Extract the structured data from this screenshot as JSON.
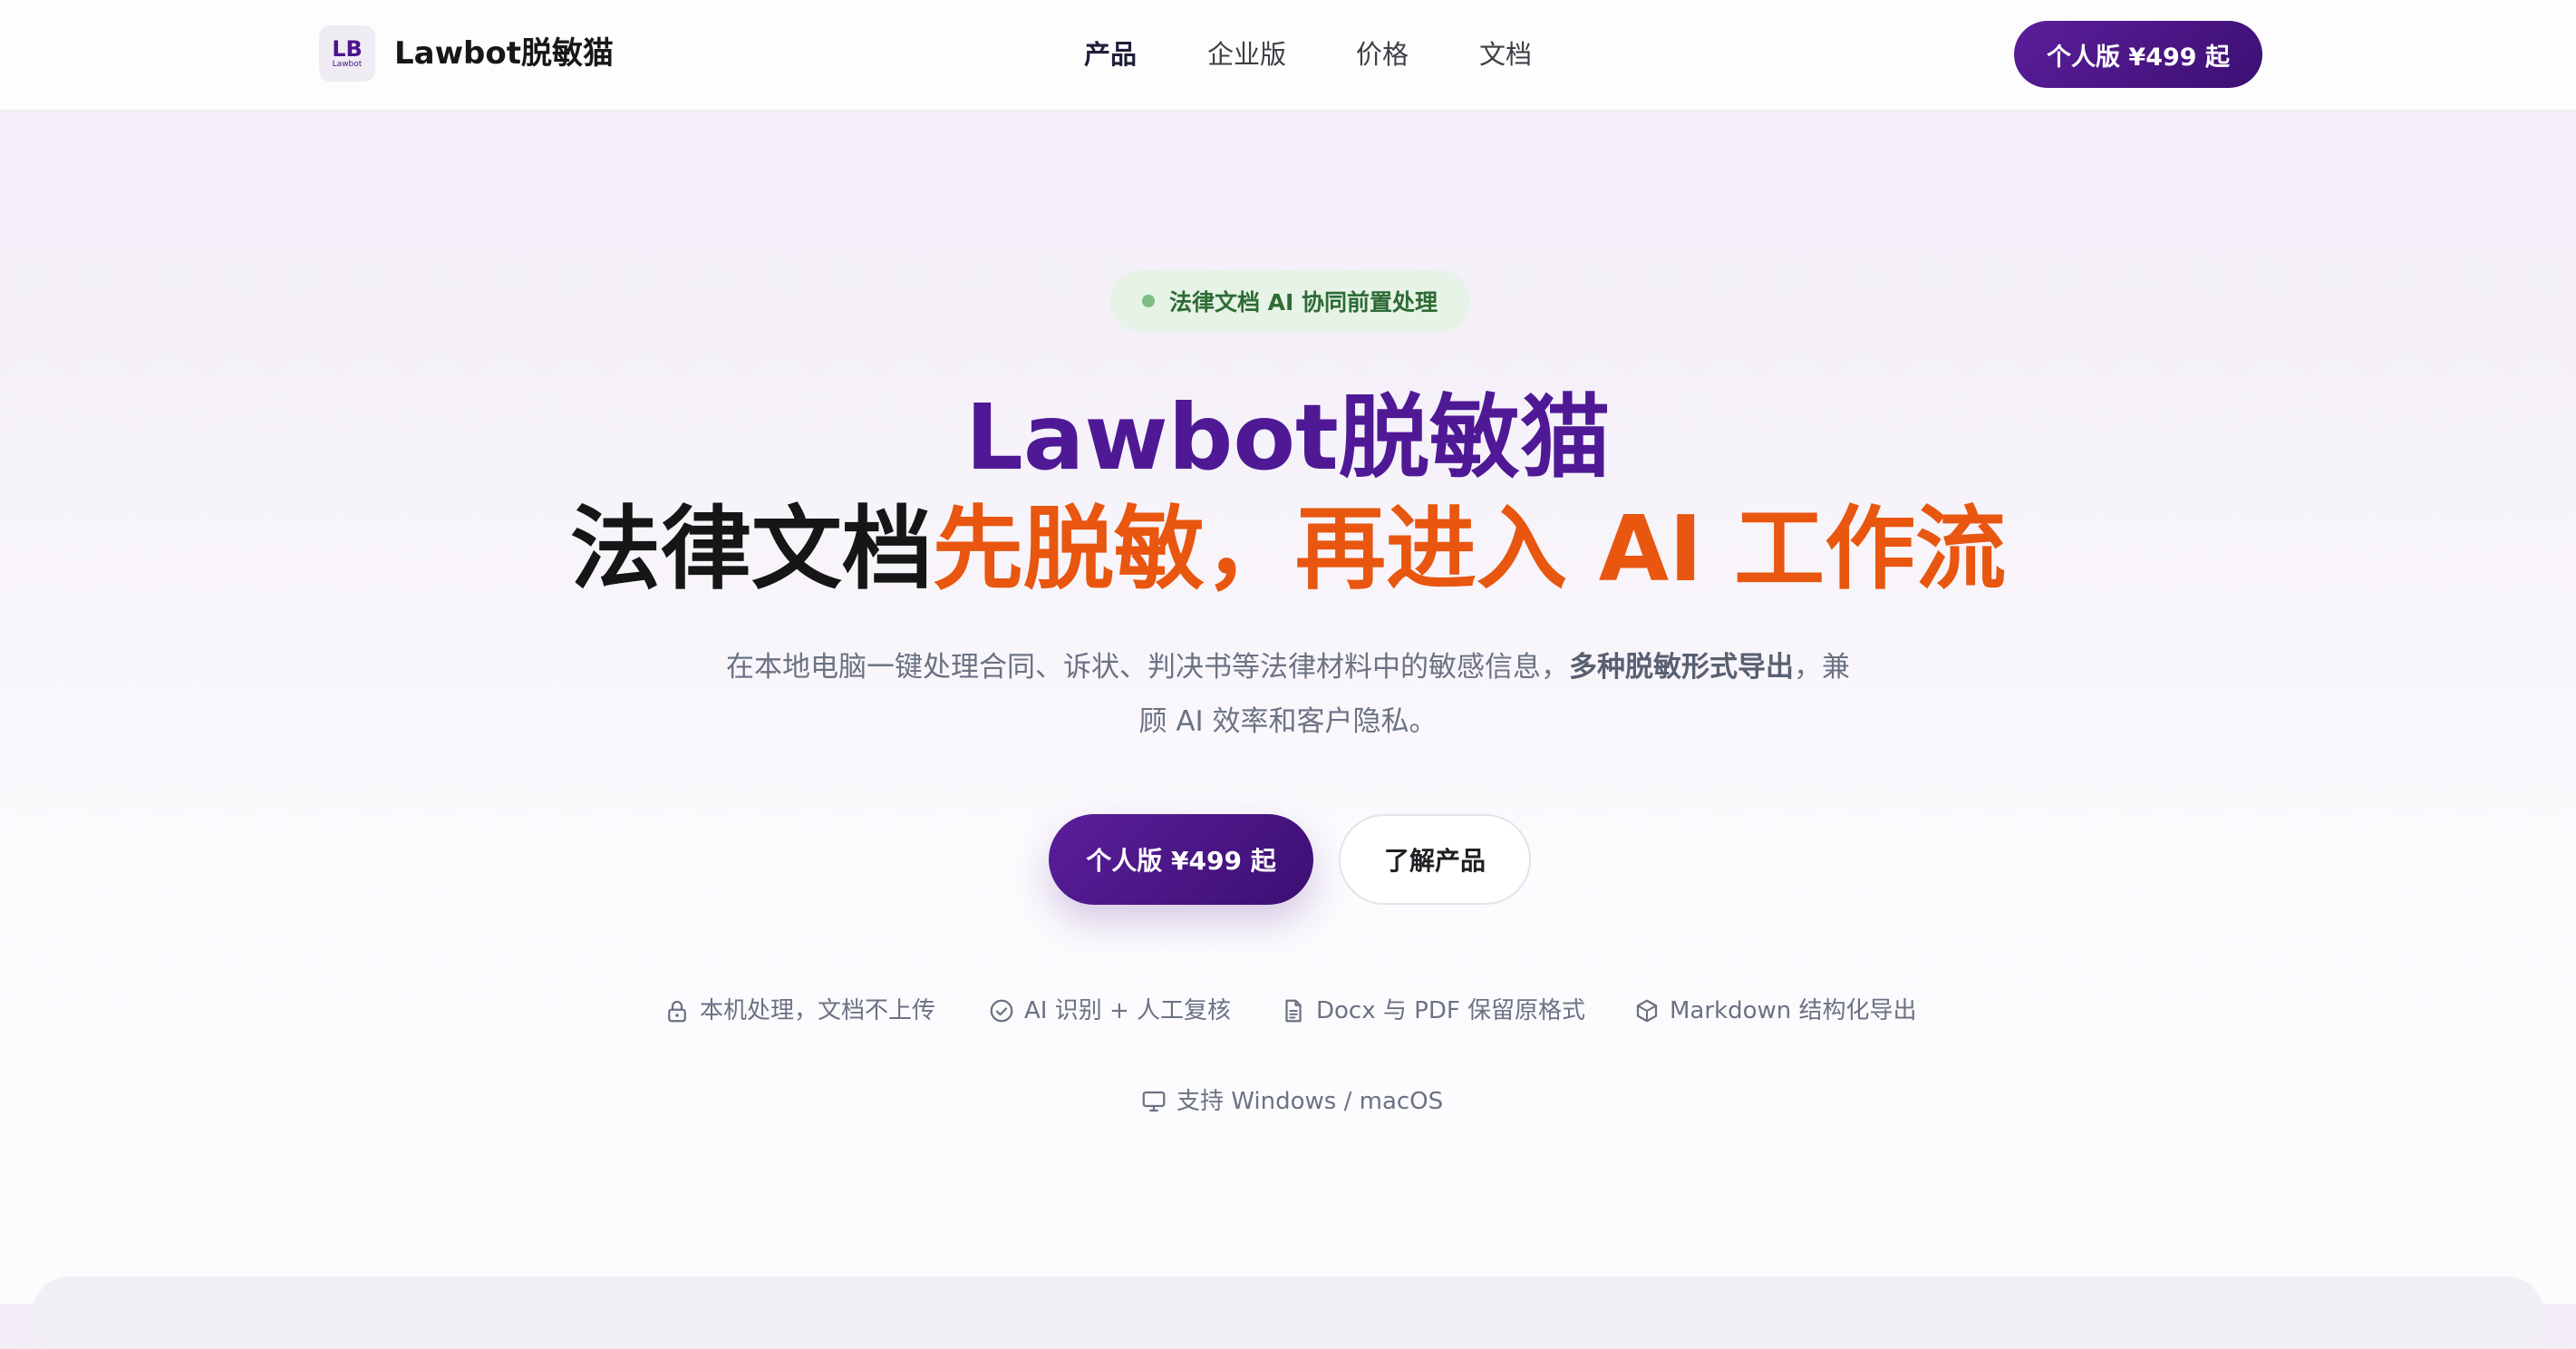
{
  "header": {
    "logo": {
      "mark": "LB",
      "caption": "Lawbot"
    },
    "brand": "Lawbot脱敏猫",
    "nav": [
      {
        "label": "产品",
        "active": true
      },
      {
        "label": "企业版",
        "active": false
      },
      {
        "label": "价格",
        "active": false
      },
      {
        "label": "文档",
        "active": false
      }
    ],
    "cta": "个人版 ¥499 起"
  },
  "hero": {
    "badge": "法律文档 AI 协同前置处理",
    "title_line1": "Lawbot脱敏猫",
    "title_line2_dark": "法律文档",
    "title_line2_accent": "先脱敏，再进入 AI 工作流",
    "subtitle_part1": "在本地电脑一键处理合同、诉状、判决书等法律材料中的敏感信息，",
    "subtitle_bold": "多种脱敏形式导出",
    "subtitle_part2": "，兼顾 AI 效率和客户隐私。",
    "primary_cta": "个人版 ¥499 起",
    "secondary_cta": "了解产品"
  },
  "features": [
    {
      "icon": "lock-icon",
      "label": "本机处理，文档不上传"
    },
    {
      "icon": "check-circle-icon",
      "label": "AI 识别 + 人工复核"
    },
    {
      "icon": "document-icon",
      "label": "Docx 与 PDF 保留原格式"
    },
    {
      "icon": "cube-icon",
      "label": "Markdown 结构化导出"
    },
    {
      "icon": "monitor-icon",
      "label": "支持 Windows / macOS"
    }
  ],
  "colors": {
    "brand_purple": "#4f1996",
    "accent_orange": "#e8560f",
    "badge_green": "#2e6b35",
    "badge_bg": "#e6f3e6"
  }
}
